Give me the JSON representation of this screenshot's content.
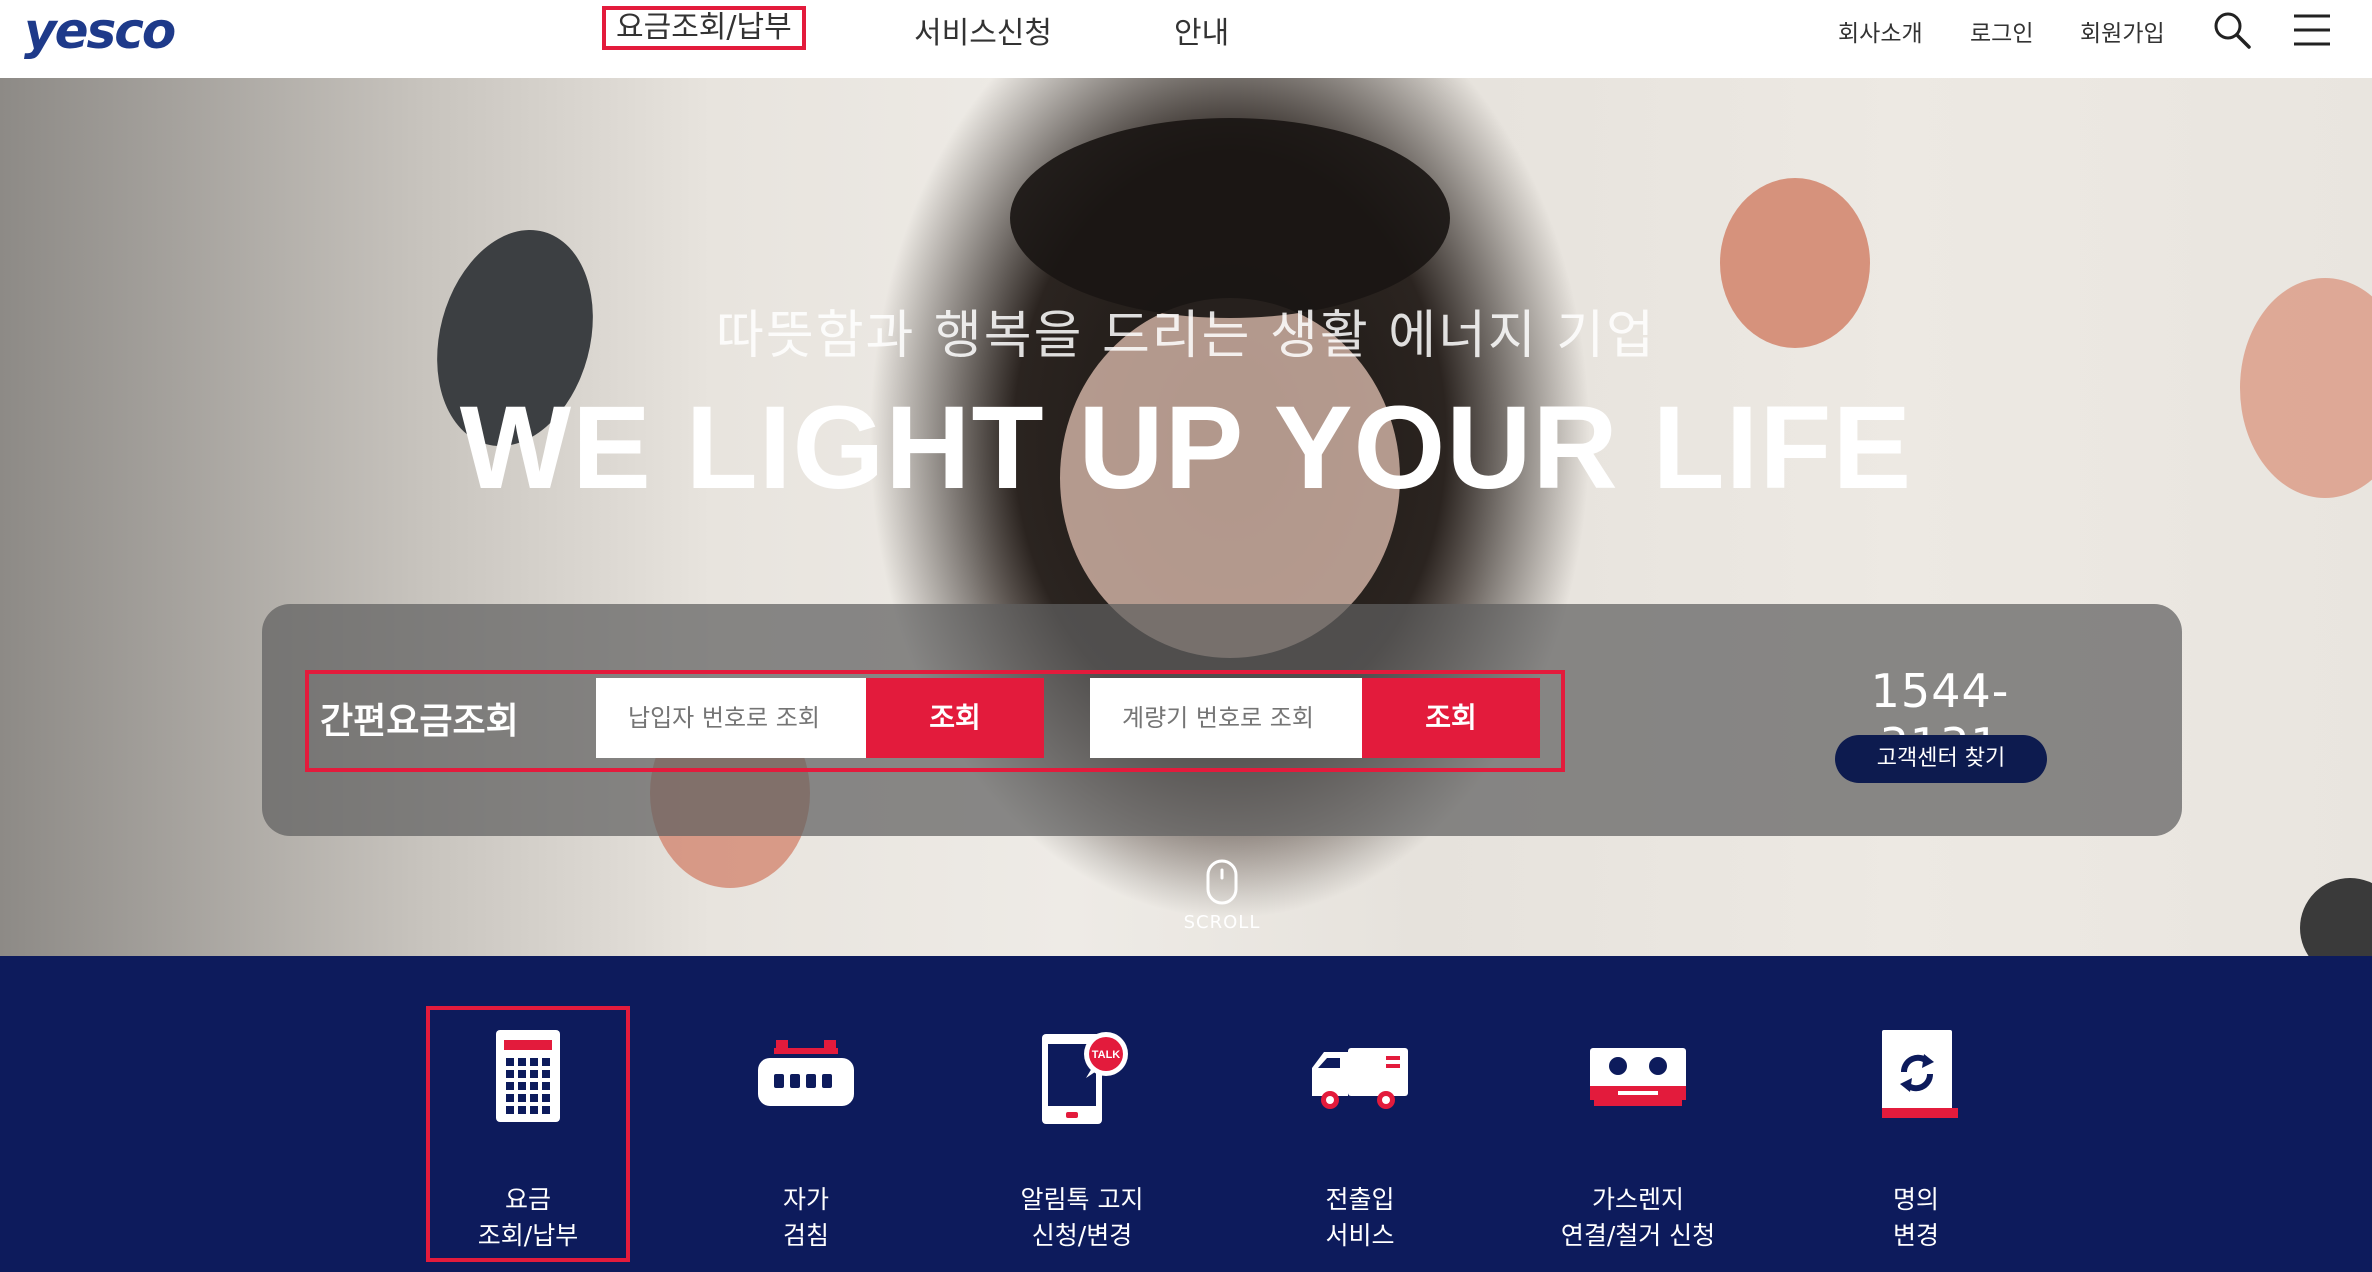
{
  "header": {
    "logo": "yesco",
    "nav": [
      "요금조회/납부",
      "서비스신청",
      "안내"
    ],
    "util": [
      "회사소개",
      "로그인",
      "회원가입"
    ]
  },
  "hero": {
    "subtitle": "따뜻함과 행복을 드리는 생활 에너지 기업",
    "title": "WE LIGHT UP YOUR LIFE",
    "quick": {
      "label": "간편요금조회",
      "input1_placeholder": "납입자 번호로 조회",
      "button1": "조회",
      "input2_placeholder": "계량기 번호로 조회",
      "button2": "조회"
    },
    "phone": "1544-3131",
    "cs_button": "고객센터 찾기",
    "scroll": "SCROLL"
  },
  "services": [
    {
      "line1": "요금",
      "line2": "조회/납부",
      "icon": "calculator-icon"
    },
    {
      "line1": "자가",
      "line2": "검침",
      "icon": "gas-meter-icon"
    },
    {
      "line1": "알림톡 고지",
      "line2": "신청/변경",
      "icon": "mobile-talk-icon"
    },
    {
      "line1": "전출입",
      "line2": "서비스",
      "icon": "moving-truck-icon"
    },
    {
      "line1": "가스렌지",
      "line2": "연결/철거 신청",
      "icon": "gas-range-icon"
    },
    {
      "line1": "명의",
      "line2": "변경",
      "icon": "name-change-icon"
    }
  ],
  "colors": {
    "accent": "#e31b3c",
    "navy": "#0d1b5c",
    "brand": "#1e3a8a"
  }
}
